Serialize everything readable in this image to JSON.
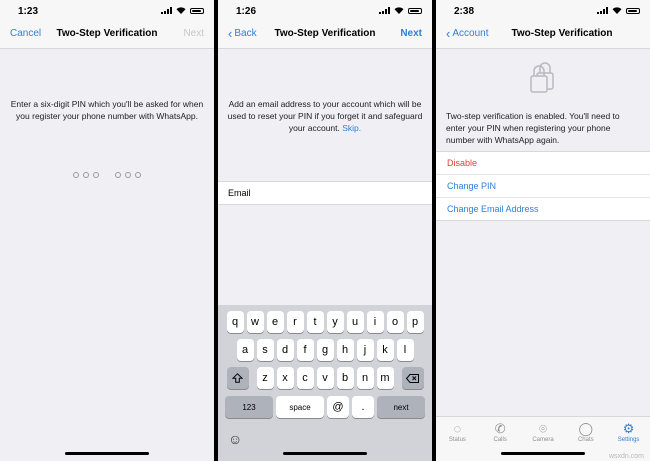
{
  "screen1": {
    "time": "1:23",
    "nav": {
      "left": "Cancel",
      "title": "Two-Step Verification",
      "right": "Next"
    },
    "message": "Enter a six-digit PIN which you'll be asked for when you register your phone number with WhatsApp."
  },
  "screen2": {
    "time": "1:26",
    "nav": {
      "left": "Back",
      "title": "Two-Step Verification",
      "right": "Next"
    },
    "message": "Add an email address to your account which will be used to reset your PIN if you forget it and safeguard your account.",
    "skip": "Skip.",
    "email_label": "Email",
    "email_value": "",
    "keyboard": {
      "row1": [
        "q",
        "w",
        "e",
        "r",
        "t",
        "y",
        "u",
        "i",
        "o",
        "p"
      ],
      "row2": [
        "a",
        "s",
        "d",
        "f",
        "g",
        "h",
        "j",
        "k",
        "l"
      ],
      "row3": [
        "z",
        "x",
        "c",
        "v",
        "b",
        "n",
        "m"
      ],
      "num": "123",
      "space": "space",
      "at": "@",
      "dot": ".",
      "next": "next"
    }
  },
  "screen3": {
    "time": "2:38",
    "nav": {
      "left": "Account",
      "title": "Two-Step Verification"
    },
    "message": "Two-step verification is enabled. You'll need to enter your PIN when registering your phone number with WhatsApp again.",
    "actions": [
      "Disable",
      "Change PIN",
      "Change Email Address"
    ],
    "tabs": [
      "Status",
      "Calls",
      "Camera",
      "Chats",
      "Settings"
    ]
  },
  "watermark": "wsxdn.com",
  "colors": {
    "accent": "#2f7fd8",
    "danger": "#e0403c",
    "background": "#efeff4"
  }
}
